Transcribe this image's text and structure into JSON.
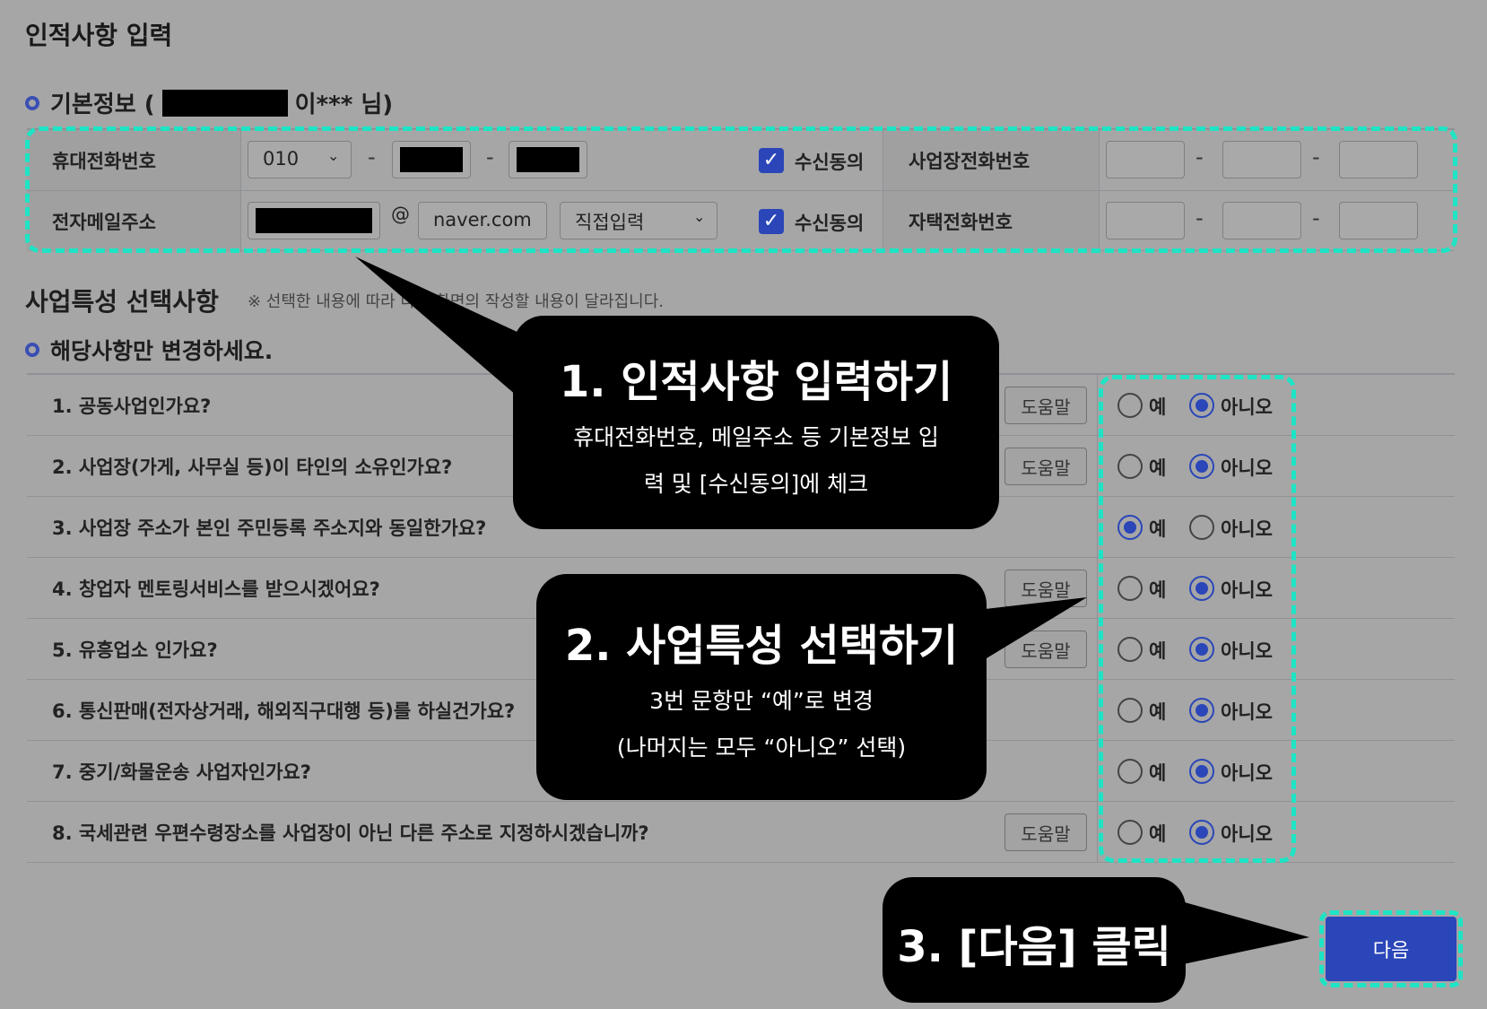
{
  "page_title": "인적사항 입력",
  "basic_info": {
    "heading_prefix": "기본정보 (",
    "heading_suffix": "이*** 님)",
    "mobile_label": "휴대전화번호",
    "mobile_prefix": "010",
    "dash": "-",
    "consent_label": "수신동의",
    "work_phone_label": "사업장전화번호",
    "email_label": "전자메일주소",
    "email_at": "@",
    "email_domain": "naver.com",
    "email_select": "직접입력",
    "home_phone_label": "자택전화번호"
  },
  "features": {
    "heading": "사업특성 선택사항",
    "note": "※ 선택한 내용에 따라 다음 화면의 작성할 내용이 달라집니다.",
    "subheading": "해당사항만 변경하세요.",
    "help_label": "도움말",
    "yes_label": "예",
    "no_label": "아니오",
    "questions": [
      {
        "text": "1. 공동사업인가요?",
        "help": true,
        "answer": "no"
      },
      {
        "text": "2. 사업장(가게, 사무실 등)이 타인의 소유인가요?",
        "help": true,
        "answer": "no"
      },
      {
        "text": "3. 사업장 주소가 본인 주민등록 주소지와 동일한가요?",
        "help": false,
        "answer": "yes"
      },
      {
        "text": "4. 창업자 멘토링서비스를 받으시겠어요?",
        "help": true,
        "answer": "no"
      },
      {
        "text": "5. 유흥업소 인가요?",
        "help": true,
        "answer": "no"
      },
      {
        "text": "6. 통신판매(전자상거래, 해외직구대행 등)를 하실건가요?",
        "help": false,
        "answer": "no"
      },
      {
        "text": "7. 중기/화물운송 사업자인가요?",
        "help": false,
        "answer": "no"
      },
      {
        "text": "8. 국세관련 우편수령장소를 사업장이 아닌 다른 주소로 지정하시겠습니까?",
        "help": true,
        "answer": "no"
      }
    ]
  },
  "callouts": {
    "c1_title": "1. 인적사항 입력하기",
    "c1_line1": "휴대전화번호, 메일주소 등 기본정보 입",
    "c1_line2": "력 및 [수신동의]에 체크",
    "c2_title": "2. 사업특성 선택하기",
    "c2_line1": "3번 문항만 “예”로 변경",
    "c2_line2": "(나머지는 모두 “아니오” 선택)",
    "c3_title": "3. [다음] 클릭"
  },
  "next_button": "다음",
  "colors": {
    "accent": "#2a46b8",
    "highlight": "#1de4c4",
    "background": "#a6a6a6"
  }
}
